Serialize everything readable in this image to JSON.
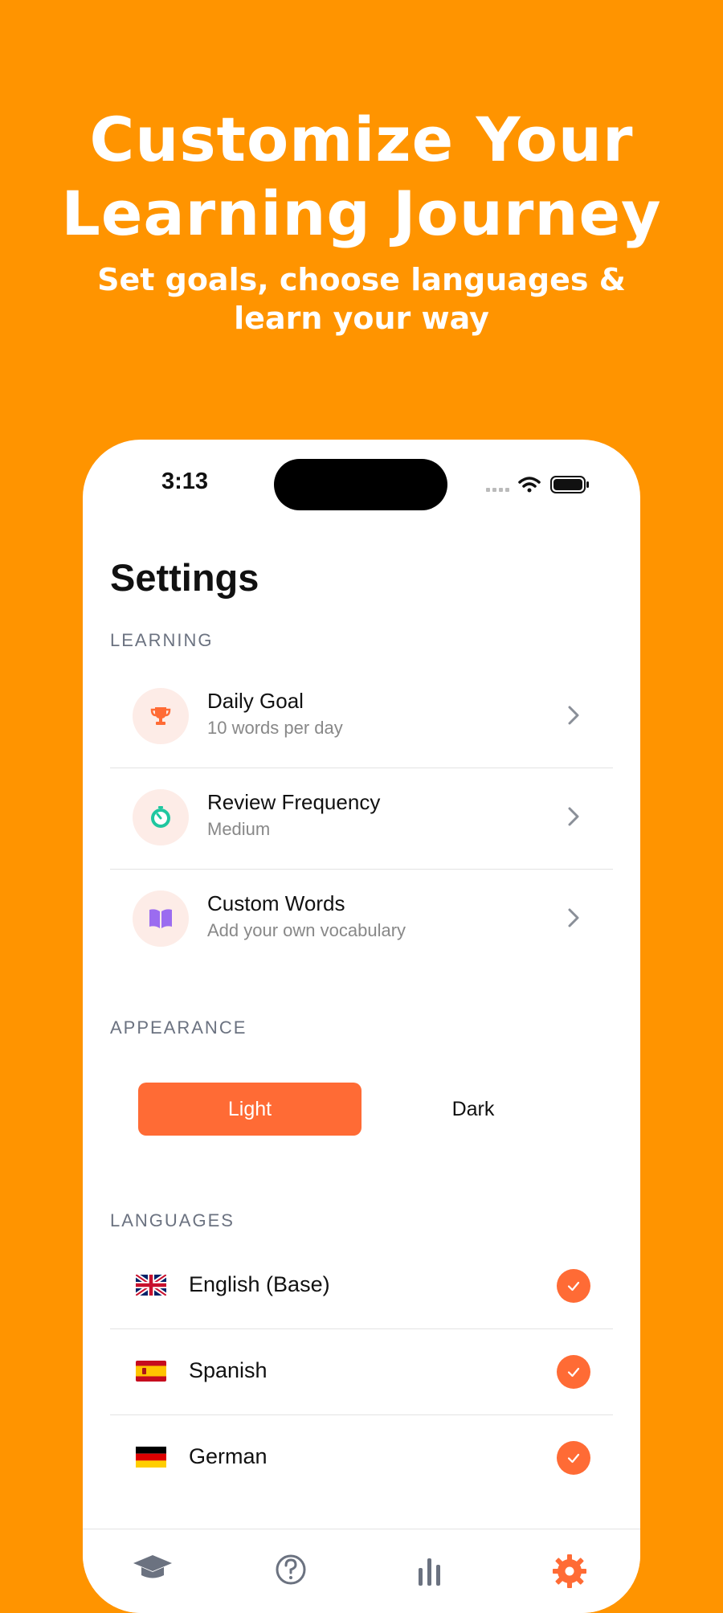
{
  "promo": {
    "title_line1": "Customize Your",
    "title_line2": "Learning Journey",
    "subtitle": "Set goals, choose languages & learn your way"
  },
  "status_bar": {
    "time": "3:13"
  },
  "screen": {
    "title": "Settings"
  },
  "sections": {
    "learning": {
      "header": "LEARNING",
      "items": [
        {
          "title": "Daily Goal",
          "subtitle": "10 words per day",
          "icon": "trophy-icon",
          "icon_color": "#FF6B35"
        },
        {
          "title": "Review Frequency",
          "subtitle": "Medium",
          "icon": "timer-icon",
          "icon_color": "#1FC7A0"
        },
        {
          "title": "Custom Words",
          "subtitle": "Add your own vocabulary",
          "icon": "book-icon",
          "icon_color": "#9B6CF0"
        }
      ]
    },
    "appearance": {
      "header": "APPEARANCE",
      "options": [
        "Light",
        "Dark"
      ],
      "selected": "Light"
    },
    "languages": {
      "header": "LANGUAGES",
      "items": [
        {
          "name": "English (Base)",
          "flag": "uk-flag-icon",
          "checked": true
        },
        {
          "name": "Spanish",
          "flag": "spain-flag-icon",
          "checked": true
        },
        {
          "name": "German",
          "flag": "germany-flag-icon",
          "checked": true
        }
      ]
    }
  },
  "tab_bar": {
    "tabs": [
      "learn-tab-icon",
      "quiz-tab-icon",
      "stats-tab-icon",
      "settings-tab-icon"
    ],
    "active": "settings-tab-icon"
  },
  "colors": {
    "background": "#FF9400",
    "accent": "#FF6B35",
    "icon_bg": "#FDECE7"
  }
}
